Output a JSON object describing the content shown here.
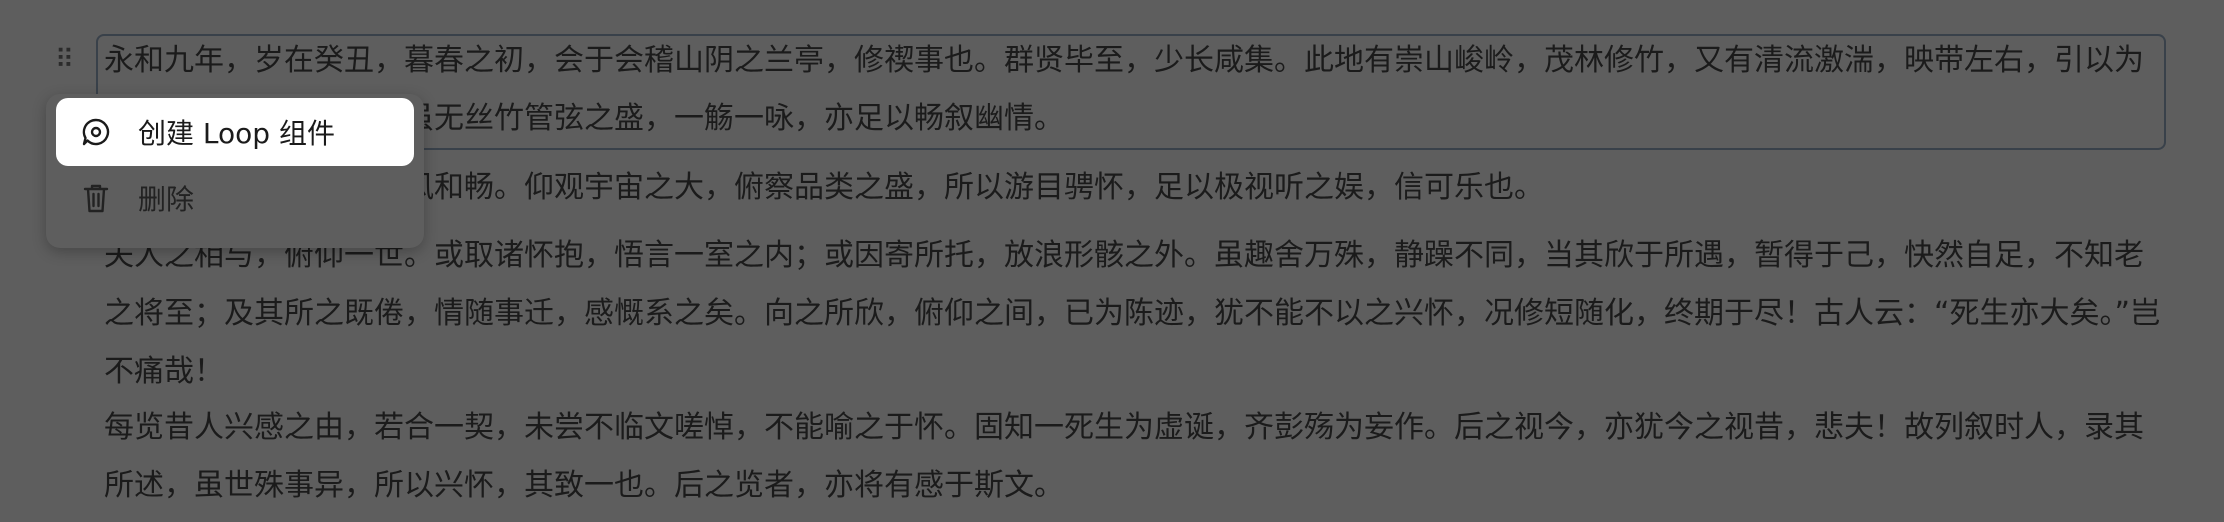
{
  "document": {
    "paragraphs": [
      {
        "text": "永和九年，岁在癸丑，暮春之初，会于会稽山阴之兰亭，修禊事也。群贤毕至，少长咸集。此地有崇山峻岭，茂林修竹，又有清流激湍，映带左右，引以为流觞曲水，列坐其次。虽无丝竹管弦之盛，一觞一咏，亦足以畅叙幽情。"
      },
      {
        "text": "是日也，天朗气清，惠风和畅。仰观宇宙之大，俯察品类之盛，所以游目骋怀，足以极视听之娱，信可乐也。"
      },
      {
        "text": "夫人之相与，俯仰一世。或取诸怀抱，悟言一室之内；或因寄所托，放浪形骸之外。虽趣舍万殊，静躁不同，当其欣于所遇，暂得于己，快然自足，不知老之将至；及其所之既倦，情随事迁，感慨系之矣。向之所欣，俯仰之间，已为陈迹，犹不能不以之兴怀，况修短随化，终期于尽！古人云：“死生亦大矣。”岂不痛哉！"
      },
      {
        "text": "每览昔人兴感之由，若合一契，未尝不临文嗟悼，不能喻之于怀。固知一死生为虚诞，齐彭殇为妄作。后之视今，亦犹今之视昔，悲夫！故列叙时人，录其所述，虽世殊事异，所以兴怀，其致一也。后之览者，亦将有感于斯文。"
      }
    ]
  },
  "context_menu": {
    "items": [
      {
        "label": "创建 Loop 组件",
        "icon": "loop-icon"
      },
      {
        "label": "删除",
        "icon": "trash-icon"
      }
    ]
  }
}
